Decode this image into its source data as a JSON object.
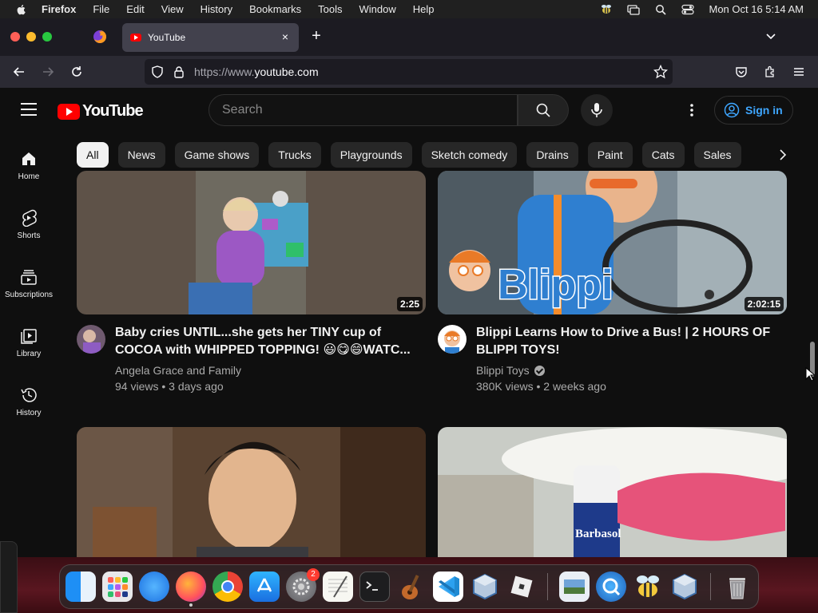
{
  "menubar": {
    "app_name": "Firefox",
    "items": [
      "File",
      "Edit",
      "View",
      "History",
      "Bookmarks",
      "Tools",
      "Window",
      "Help"
    ],
    "clock": "Mon Oct 16  5:14 AM"
  },
  "browser": {
    "tab_title": "YouTube",
    "new_tab_symbol": "+",
    "close_symbol": "×",
    "url_prefix": "https://www.",
    "url_domain": "youtube.com"
  },
  "youtube": {
    "logo_text": "YouTube",
    "search_placeholder": "Search",
    "signin_label": "Sign in",
    "rail": [
      {
        "label": "Home",
        "icon": "home-icon"
      },
      {
        "label": "Shorts",
        "icon": "shorts-icon"
      },
      {
        "label": "Subscriptions",
        "icon": "subscriptions-icon"
      },
      {
        "label": "Library",
        "icon": "library-icon"
      },
      {
        "label": "History",
        "icon": "history-icon"
      }
    ],
    "chips": [
      "All",
      "News",
      "Game shows",
      "Trucks",
      "Playgrounds",
      "Sketch comedy",
      "Drains",
      "Paint",
      "Cats",
      "Sales"
    ],
    "videos": [
      {
        "title": "Baby cries UNTIL...she gets her TINY cup of COCOA with WHIPPED TOPPING! 😃😋😄WATC...",
        "channel": "Angela Grace and Family",
        "meta": "94 views • 3 days ago",
        "duration": "2:25",
        "verified": false
      },
      {
        "title": "Blippi Learns How to Drive a Bus! | 2 HOURS OF BLIPPI TOYS!",
        "channel": "Blippi Toys",
        "meta": "380K views • 2 weeks ago",
        "duration": "2:02:15",
        "verified": true
      }
    ],
    "blippi_logo_text": "Blippi",
    "barbasol_text": "Barbasol"
  },
  "dock": {
    "apps": [
      "Finder",
      "Launchpad",
      "Safari",
      "Firefox",
      "Chrome",
      "App Store",
      "System Settings",
      "TextEdit",
      "Terminal",
      "GarageBand",
      "Visual Studio Code",
      "VirtualBox",
      "Roblox",
      "Preview",
      "QuickTime",
      "Bee",
      "VirtualBox VM",
      "Trash"
    ],
    "settings_badge": "2"
  }
}
